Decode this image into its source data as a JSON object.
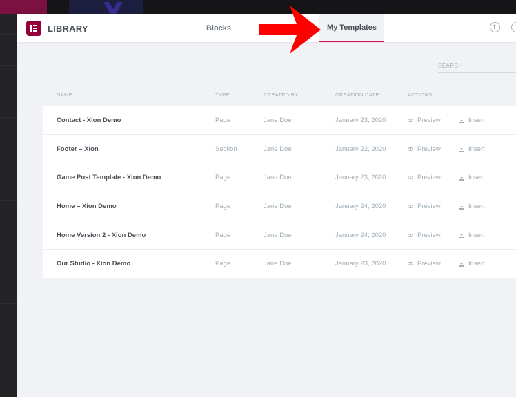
{
  "header": {
    "title": "LIBRARY",
    "tabs": [
      {
        "label": "Blocks"
      },
      {
        "label": "My Templates",
        "active": true
      }
    ],
    "icons": [
      "upload-icon",
      "sync-icon"
    ]
  },
  "search": {
    "placeholder": "SEARCH"
  },
  "table": {
    "columns": [
      "NAME",
      "TYPE",
      "CREATED BY",
      "CREATION DATE",
      "ACTIONS"
    ],
    "rows": [
      {
        "name": "Contact - Xion Demo",
        "type": "Page",
        "author": "Jane Doe",
        "date": "January 23, 2020",
        "preview": "Preview",
        "insert": "Insert"
      },
      {
        "name": "Footer – Xion",
        "type": "Section",
        "author": "Jane Doe",
        "date": "January 22, 2020",
        "preview": "Preview",
        "insert": "Insert"
      },
      {
        "name": "Game Post Template - Xion Demo",
        "type": "Page",
        "author": "Jane Doe",
        "date": "January 23, 2020",
        "preview": "Preview",
        "insert": "Insert"
      },
      {
        "name": "Home – Xion Demo",
        "type": "Page",
        "author": "Jane Doe",
        "date": "January 24, 2020",
        "preview": "Preview",
        "insert": "Insert"
      },
      {
        "name": "Home Version 2 - Xion Demo",
        "type": "Page",
        "author": "Jane Doe",
        "date": "January 24, 2020",
        "preview": "Preview",
        "insert": "Insert"
      },
      {
        "name": "Our Studio - Xion Demo",
        "type": "Page",
        "author": "Jane Doe",
        "date": "January 23, 2020",
        "preview": "Preview",
        "insert": "Insert"
      }
    ]
  },
  "colors": {
    "brand": "#93003c",
    "active_tab_underline": "#d30c5c",
    "annotation_arrow": "#ff0000"
  }
}
